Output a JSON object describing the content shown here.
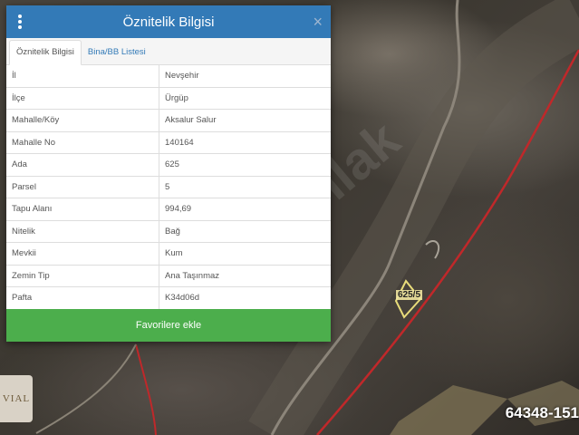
{
  "panel": {
    "title": "Öznitelik Bilgisi",
    "close_glyph": "×",
    "tabs": [
      {
        "label": "Öznitelik Bilgisi",
        "active": true
      },
      {
        "label": "Bina/BB Listesi",
        "active": false
      }
    ],
    "rows": [
      {
        "key": "İl",
        "value": "Nevşehir"
      },
      {
        "key": "İlçe",
        "value": "Ürgüp"
      },
      {
        "key": "Mahalle/Köy",
        "value": "Aksalur Salur"
      },
      {
        "key": "Mahalle No",
        "value": "140164"
      },
      {
        "key": "Ada",
        "value": "625"
      },
      {
        "key": "Parsel",
        "value": "5"
      },
      {
        "key": "Tapu Alanı",
        "value": "994,69"
      },
      {
        "key": "Nitelik",
        "value": "Bağ"
      },
      {
        "key": "Mevkii",
        "value": "Kum"
      },
      {
        "key": "Zemin Tip",
        "value": "Ana Taşınmaz"
      },
      {
        "key": "Pafta",
        "value": "K34d06d"
      }
    ],
    "favorite_button": "Favorilere ekle"
  },
  "map": {
    "parcel_label": "625/5",
    "watermark": "nlak",
    "logo_text": "VIAL",
    "listing_code": "64348-151",
    "colors": {
      "boundary": "#c0282a",
      "parcel_outline": "#e8dc7a",
      "header": "#337ab7",
      "button": "#4cae4c"
    }
  }
}
